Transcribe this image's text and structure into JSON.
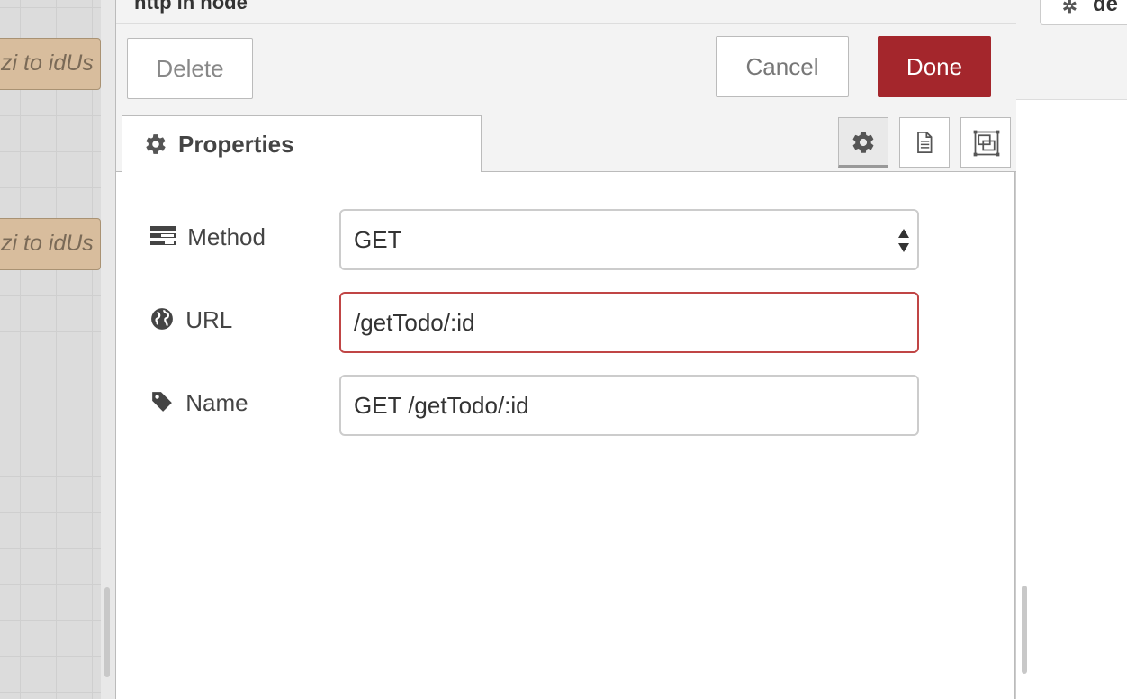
{
  "workspace": {
    "nodes": [
      {
        "label": "zi to idUs"
      },
      {
        "label": "zi to idUs"
      }
    ]
  },
  "right_panel": {
    "tab_label": "de"
  },
  "tray": {
    "title": "http in node",
    "toolbar": {
      "delete_label": "Delete",
      "cancel_label": "Cancel",
      "done_label": "Done"
    },
    "tabs": {
      "properties_label": "Properties",
      "settings_icon": "gear-icon",
      "description_icon": "document-icon",
      "appearance_icon": "frame-icon"
    },
    "form": {
      "method": {
        "label": "Method",
        "value": "GET",
        "icon": "list-icon"
      },
      "url": {
        "label": "URL",
        "value": "/getTodo/:id",
        "icon": "globe-icon"
      },
      "name": {
        "label": "Name",
        "value": "GET /getTodo/:id",
        "icon": "tag-icon"
      }
    }
  },
  "colors": {
    "done_button": "#a4262c",
    "invalid_border": "#c04545",
    "node_fill": "#d8bd9d"
  }
}
